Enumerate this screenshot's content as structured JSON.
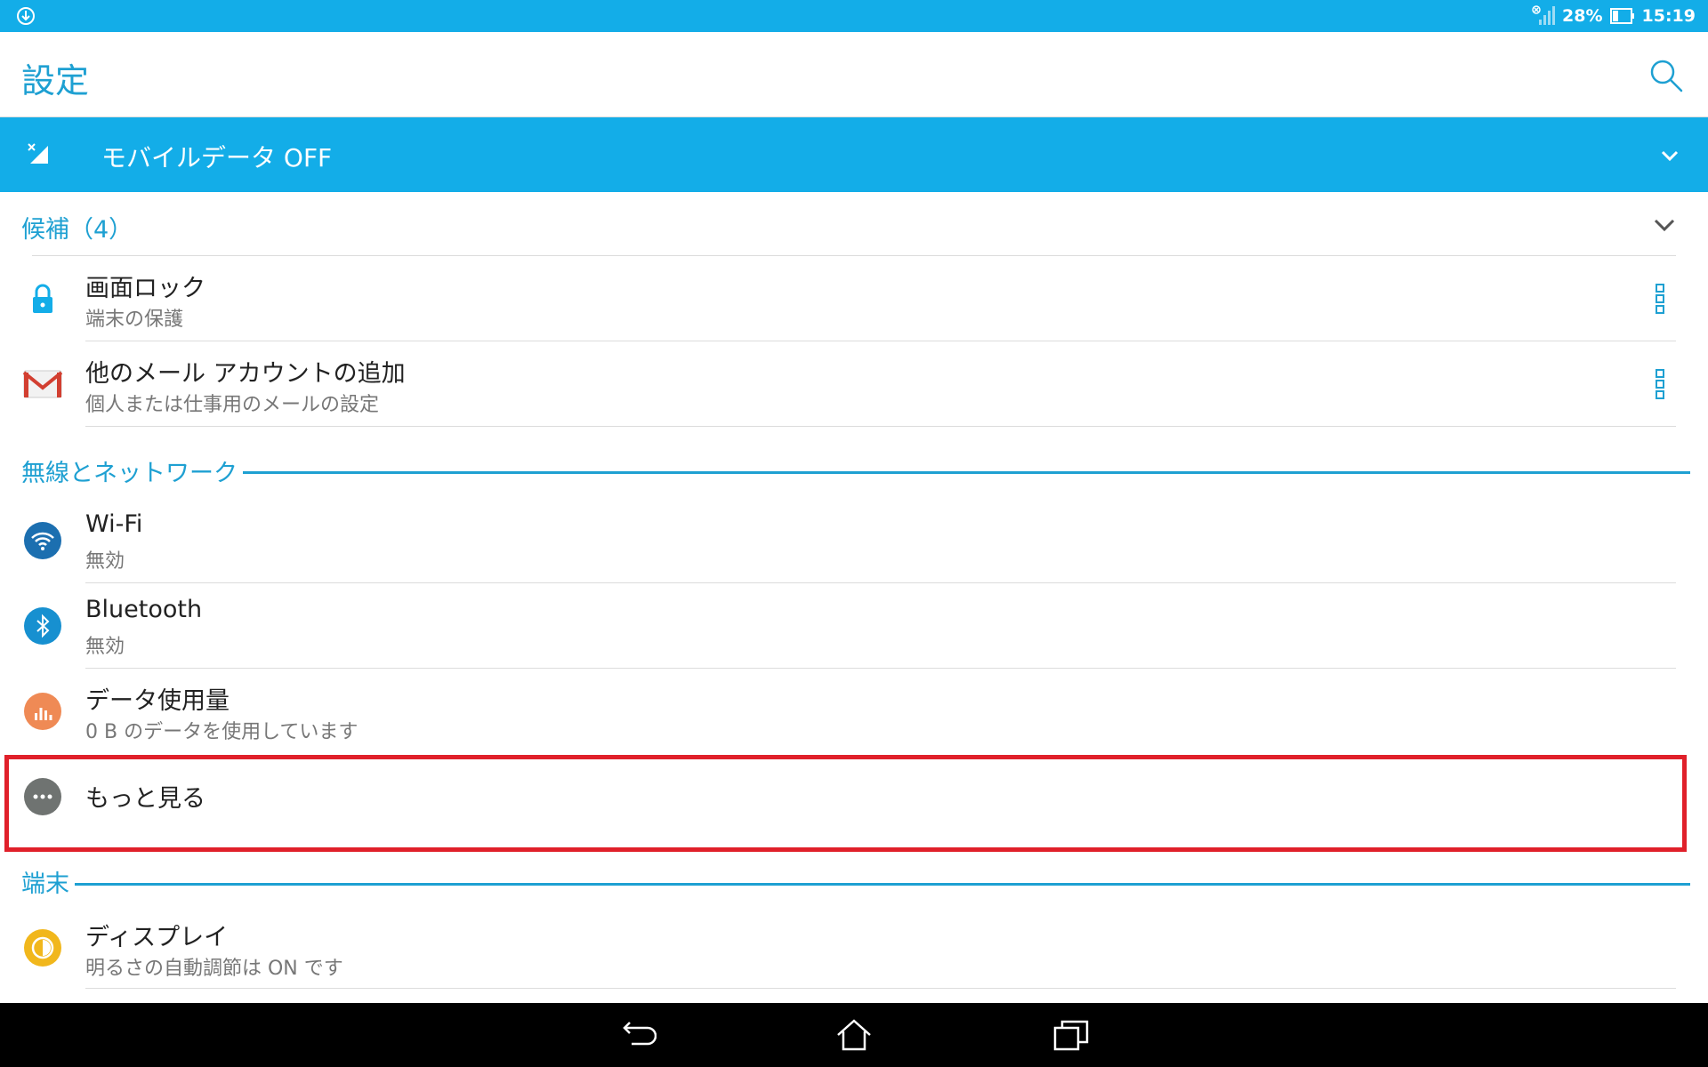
{
  "status_bar": {
    "left_icon": "usb-debug-icon",
    "battery_percent": "28%",
    "time": "15:19",
    "icons": [
      "no-sim-signal-icon",
      "battery-icon"
    ]
  },
  "app_bar": {
    "title": "設定",
    "search_icon": "search-icon"
  },
  "mobile_data_banner": {
    "icon": "mobile-data-off-icon",
    "label": "モバイルデータ OFF",
    "expand_icon": "chevron-down-icon"
  },
  "suggestions": {
    "header": "候補（4）",
    "items": [
      {
        "title": "画面ロック",
        "subtitle": "端末の保護",
        "icon": "lock-icon"
      },
      {
        "title": "他のメール アカウントの追加",
        "subtitle": "個人または仕事用のメールの設定",
        "icon": "gmail-icon"
      }
    ]
  },
  "sections": [
    {
      "title": "無線とネットワーク",
      "items": [
        {
          "title": "Wi-Fi",
          "subtitle": "無効",
          "icon": "wifi-icon"
        },
        {
          "title": "Bluetooth",
          "subtitle": "無効",
          "icon": "bluetooth-icon"
        },
        {
          "title": "データ使用量",
          "subtitle": "0 B のデータを使用しています",
          "icon": "data-usage-icon"
        },
        {
          "title": "もっと見る",
          "subtitle": "",
          "icon": "more-icon"
        }
      ]
    },
    {
      "title": "端末",
      "items": [
        {
          "title": "ディスプレイ",
          "subtitle": "明るさの自動調節は ON です",
          "icon": "display-brightness-icon"
        }
      ]
    }
  ],
  "nav_bar": {
    "icons": [
      "back-icon",
      "home-icon",
      "recents-icon"
    ]
  },
  "colors": {
    "accent": "#13ade8",
    "section_text": "#1ea0d2",
    "highlight": "#e0202a",
    "navbar": "#000000"
  }
}
